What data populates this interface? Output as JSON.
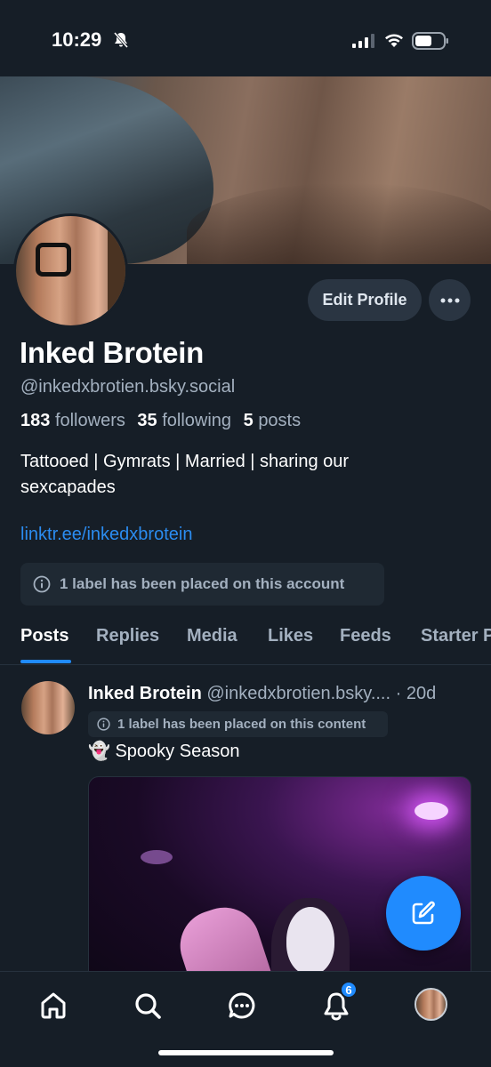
{
  "status_bar": {
    "time": "10:29",
    "icons": [
      "bell-slash-icon",
      "cellular-signal-icon",
      "wifi-icon",
      "battery-icon"
    ]
  },
  "profile": {
    "display_name": "Inked Brotein",
    "handle": "@inkedxbrotien.bsky.social",
    "stats": {
      "followers_count": "183",
      "followers_label": "followers",
      "following_count": "35",
      "following_label": "following",
      "posts_count": "5",
      "posts_label": "posts"
    },
    "bio": "Tattooed | Gymrats | Married | sharing our sexcapades",
    "link": "linktr.ee/inkedxbrotein",
    "account_label": "1 label has been placed on this account",
    "edit_button": "Edit Profile"
  },
  "tabs": [
    "Posts",
    "Replies",
    "Media",
    "Likes",
    "Feeds",
    "Starter P"
  ],
  "active_tab": "Posts",
  "post": {
    "author_name": "Inked Brotein",
    "author_handle": "@inkedxbrotien.bsky....",
    "time": "· 20d",
    "content_label": "1 label has been placed on this content",
    "text": "👻 Spooky Season"
  },
  "nav": {
    "items": [
      "home-icon",
      "search-icon",
      "chat-icon",
      "notifications-icon",
      "profile-avatar"
    ],
    "notification_badge": "6"
  },
  "colors": {
    "background": "#161e27",
    "accent": "#208bfe",
    "link": "#2b8cf0",
    "muted_text": "#a3b0bf",
    "button_bg": "#2a3542"
  }
}
